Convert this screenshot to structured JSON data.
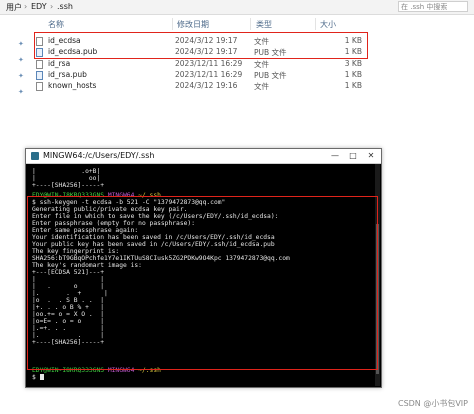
{
  "breadcrumb": {
    "root": "用户",
    "user": "EDY",
    "folder": ".ssh",
    "search_placeholder": "在 .ssh 中搜索"
  },
  "columns": {
    "name": "名称",
    "date": "修改日期",
    "type": "类型",
    "size": "大小"
  },
  "files": [
    {
      "name": "id_ecdsa",
      "date": "2024/3/12 19:17",
      "type": "文件",
      "size": "1 KB",
      "icon": "file-icon"
    },
    {
      "name": "id_ecdsa.pub",
      "date": "2024/3/12 19:17",
      "type": "PUB 文件",
      "size": "1 KB",
      "icon": "pub-file-icon"
    },
    {
      "name": "id_rsa",
      "date": "2023/12/11 16:29",
      "type": "文件",
      "size": "3 KB",
      "icon": "file-icon"
    },
    {
      "name": "id_rsa.pub",
      "date": "2023/12/11 16:29",
      "type": "PUB 文件",
      "size": "1 KB",
      "icon": "pub-file-icon"
    },
    {
      "name": "known_hosts",
      "date": "2024/3/12 19:16",
      "type": "文件",
      "size": "1 KB",
      "icon": "file-icon"
    }
  ],
  "terminal": {
    "title": "MINGW64:/c/Users/EDY/.ssh",
    "buttons": {
      "minimize": "—",
      "maximize": "□",
      "close": "✕"
    },
    "prompt_host": "EDY@WIN-I8KRQ333GNS",
    "prompt_env": "MINGW64",
    "prompt_path": "~/.ssh",
    "top_art": [
      "|            .o+B|",
      "|              oo|",
      "+----[SHA256]-----+"
    ],
    "command": "$ ssh-keygen -t ecdsa -b 521 -C \"1379472873@qq.com\"",
    "output": [
      "Generating public/private ecdsa key pair.",
      "Enter file in which to save the key (/c/Users/EDY/.ssh/id_ecdsa):",
      "Enter passphrase (empty for no passphrase):",
      "Enter same passphrase again:",
      "Your identification has been saved in /c/Users/EDY/.ssh/id_ecdsa",
      "Your public key has been saved in /c/Users/EDY/.ssh/id_ecdsa.pub",
      "The key fingerprint is:",
      "SHA256:bT9GBqOPchfe1Y7e1IKTUuS8CIusk5ZG2PDKw9O4Kpc 1379472873@qq.com",
      "The key's randomart image is:",
      "+---[ECDSA 521]---+",
      "|                 |",
      "|   .      o      |",
      "|.       .  +      |",
      "|o  .  . S B . .  |",
      "|+. . . o B % +   |",
      "|oo.+= o = X O .  |",
      "|o=E= . o = o     |",
      "|.=+. . .         |",
      "|.          .     |",
      "+----[SHA256]-----+"
    ],
    "final_prompt": "$"
  },
  "watermark": "CSDN @小书包VIP",
  "colors": {
    "highlight_box": "#e0241b",
    "prompt_green": "#3fd13f",
    "prompt_purple": "#c35ad1",
    "prompt_yellow": "#d8c43a"
  }
}
